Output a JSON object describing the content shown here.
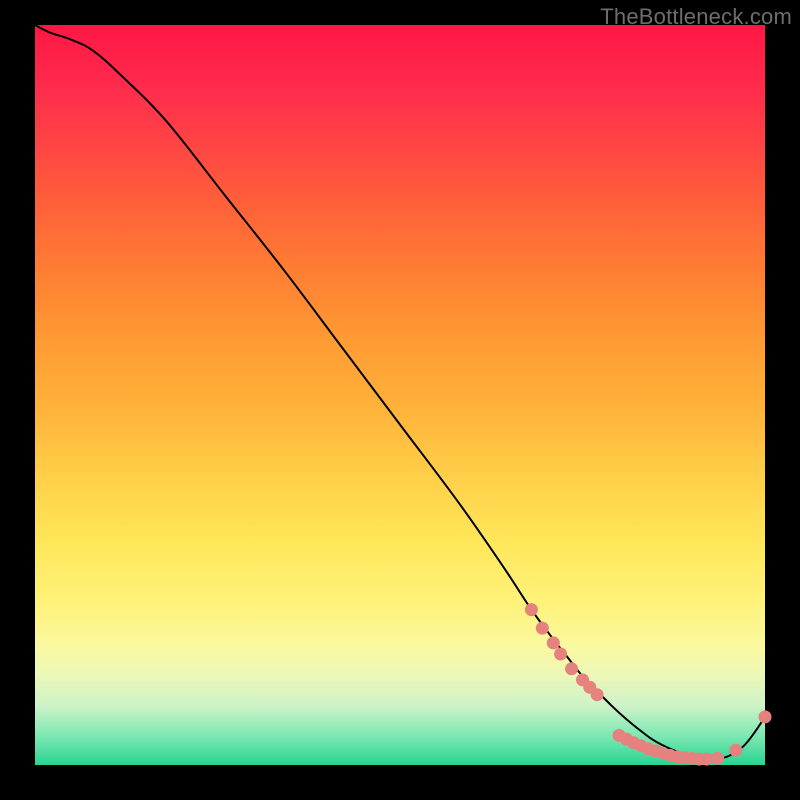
{
  "watermark": "TheBottleneck.com",
  "colors": {
    "gradient_top": "#ff1744",
    "gradient_mid": "#ffd24a",
    "gradient_bottom": "#28d492",
    "curve": "#000000",
    "markers": "#e6827d",
    "page_bg": "#000000"
  },
  "chart_data": {
    "type": "line",
    "title": "",
    "xlabel": "",
    "ylabel": "",
    "xlim": [
      0,
      100
    ],
    "ylim": [
      0,
      100
    ],
    "grid": false,
    "legend": false,
    "notes": "Black curve over heat-gradient background. No axis tick labels are shown in the image, so values below are read off by proportional position within the plot area.",
    "series": [
      {
        "name": "curve",
        "x": [
          0,
          2,
          5,
          8,
          12,
          18,
          26,
          34,
          42,
          50,
          58,
          64,
          68,
          71,
          73,
          75,
          77,
          79,
          81,
          83,
          85,
          88,
          91,
          93,
          95,
          97,
          98.5,
          100
        ],
        "y": [
          100,
          99,
          98,
          96.5,
          93,
          87,
          77,
          67,
          56.5,
          46,
          35.5,
          27,
          21,
          17,
          14.5,
          12,
          10,
          8,
          6.2,
          4.6,
          3.2,
          1.8,
          1.0,
          0.8,
          1.2,
          2.5,
          4.3,
          6.5
        ]
      }
    ],
    "markers": {
      "name": "highlighted-points",
      "points": [
        {
          "x": 68.0,
          "y": 21.0
        },
        {
          "x": 69.5,
          "y": 18.5
        },
        {
          "x": 71.0,
          "y": 16.5
        },
        {
          "x": 72.0,
          "y": 15.0
        },
        {
          "x": 73.5,
          "y": 13.0
        },
        {
          "x": 75.0,
          "y": 11.5
        },
        {
          "x": 76.0,
          "y": 10.5
        },
        {
          "x": 77.0,
          "y": 9.5
        },
        {
          "x": 80.0,
          "y": 4.0
        },
        {
          "x": 81.0,
          "y": 3.5
        },
        {
          "x": 82.0,
          "y": 3.0
        },
        {
          "x": 83.0,
          "y": 2.6
        },
        {
          "x": 84.0,
          "y": 2.2
        },
        {
          "x": 85.0,
          "y": 1.9
        },
        {
          "x": 86.0,
          "y": 1.6
        },
        {
          "x": 87.0,
          "y": 1.3
        },
        {
          "x": 88.0,
          "y": 1.1
        },
        {
          "x": 89.0,
          "y": 1.0
        },
        {
          "x": 90.0,
          "y": 0.9
        },
        {
          "x": 91.0,
          "y": 0.8
        },
        {
          "x": 92.0,
          "y": 0.8
        },
        {
          "x": 93.5,
          "y": 0.9
        },
        {
          "x": 96.0,
          "y": 2.0
        },
        {
          "x": 100.0,
          "y": 6.5
        }
      ]
    }
  }
}
